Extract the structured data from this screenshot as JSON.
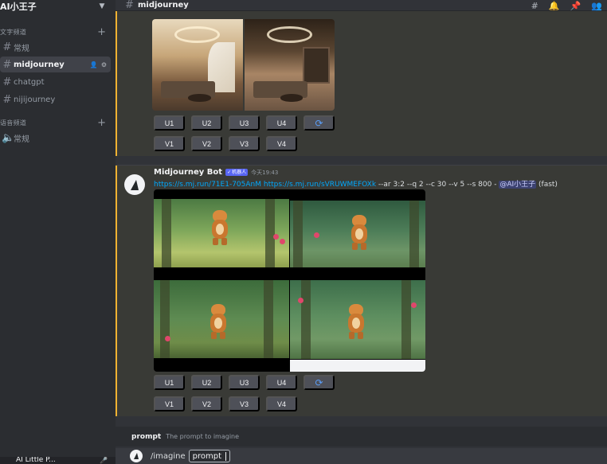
{
  "server": {
    "name": "AI小王子"
  },
  "sidebar": {
    "text_category": "文字频道",
    "voice_category": "语音频道",
    "text_channels": [
      {
        "label": "常规"
      },
      {
        "label": "midjourney"
      },
      {
        "label": "chatgpt"
      },
      {
        "label": "nijijourney"
      }
    ],
    "voice_channels": [
      {
        "label": "常规"
      }
    ],
    "user": {
      "name": "AI Little P..."
    }
  },
  "header": {
    "channel": "midjourney"
  },
  "messages": {
    "first": {
      "buttons_u": [
        "U1",
        "U2",
        "U3",
        "U4"
      ],
      "buttons_v": [
        "V1",
        "V2",
        "V3",
        "V4"
      ],
      "refresh_icon": "refresh-icon"
    },
    "second": {
      "author": "Midjourney Bot",
      "bot_tag": "机器人",
      "timestamp": "今天19:43",
      "link1": "https://s.mj.run/71E1-705AnM",
      "link2": "https://s.mj.run/sVRUWMEFOXk",
      "params": " --ar 3:2 --q 2 --c 30 --v 5 --s 800 - ",
      "mention": "@AI小王子",
      "mode": " (fast)",
      "buttons_u": [
        "U1",
        "U2",
        "U3",
        "U4"
      ],
      "buttons_v": [
        "V1",
        "V2",
        "V3",
        "V4"
      ],
      "refresh_icon": "refresh-icon"
    }
  },
  "command_hint": {
    "name": "prompt",
    "description": "The prompt to imagine"
  },
  "input": {
    "command": "/imagine",
    "option": "prompt"
  },
  "colors": {
    "accent_bar": "#f0b232",
    "link": "#00a8fc",
    "bot_tag": "#5865f2",
    "button": "#4e5058"
  }
}
